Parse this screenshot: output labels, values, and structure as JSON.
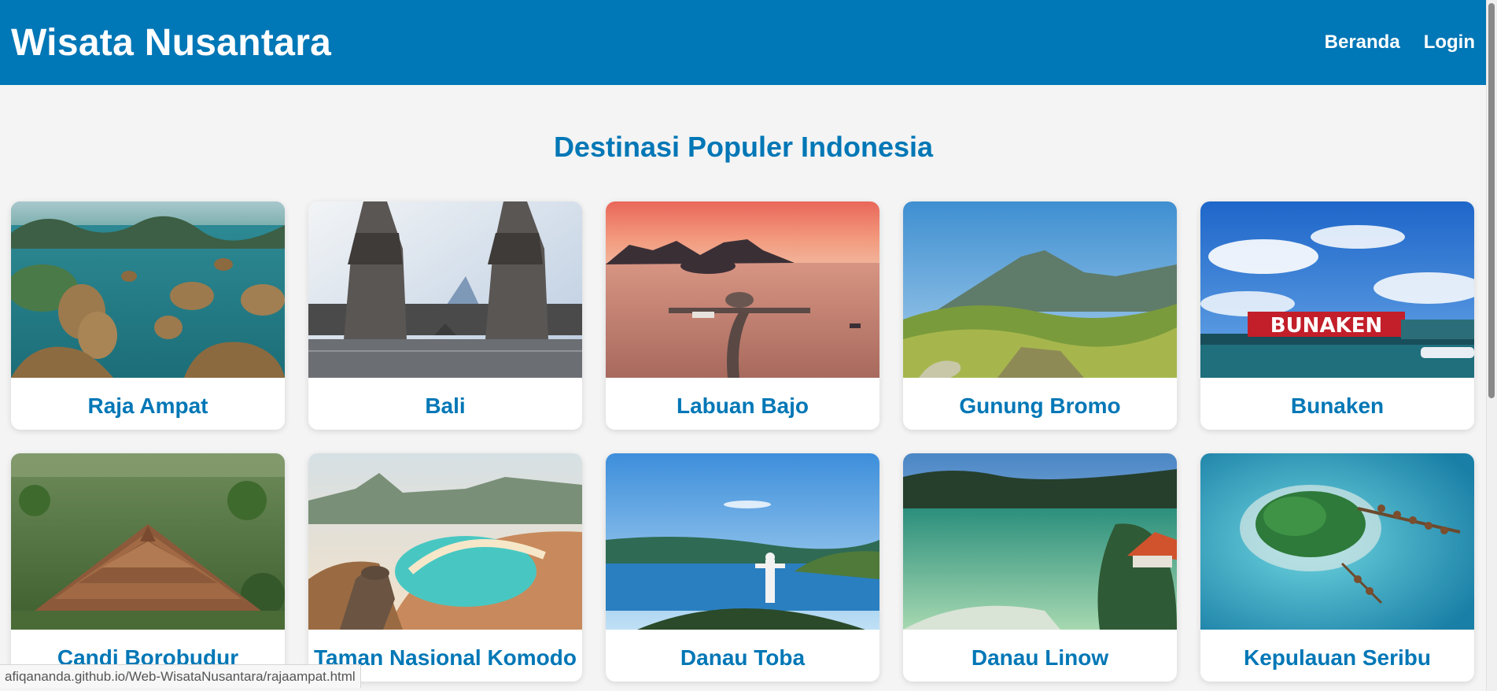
{
  "header": {
    "title": "Wisata Nusantara",
    "nav": [
      "Beranda",
      "Login"
    ]
  },
  "main": {
    "section_title": "Destinasi Populer Indonesia",
    "destinations": [
      "Raja Ampat",
      "Bali",
      "Labuan Bajo",
      "Gunung Bromo",
      "Bunaken",
      "Candi Borobudur",
      "Taman Nasional Komodo",
      "Danau Toba",
      "Danau Linow",
      "Kepulauan Seribu"
    ],
    "bunaken_sign": "BUNAKEN"
  },
  "status_bar": {
    "url": "afiqananda.github.io/Web-WisataNusantara/rajaampat.html"
  },
  "colors": {
    "header_bg": "#0077b6",
    "accent": "#0077b6",
    "page_bg": "#f4f4f4"
  }
}
